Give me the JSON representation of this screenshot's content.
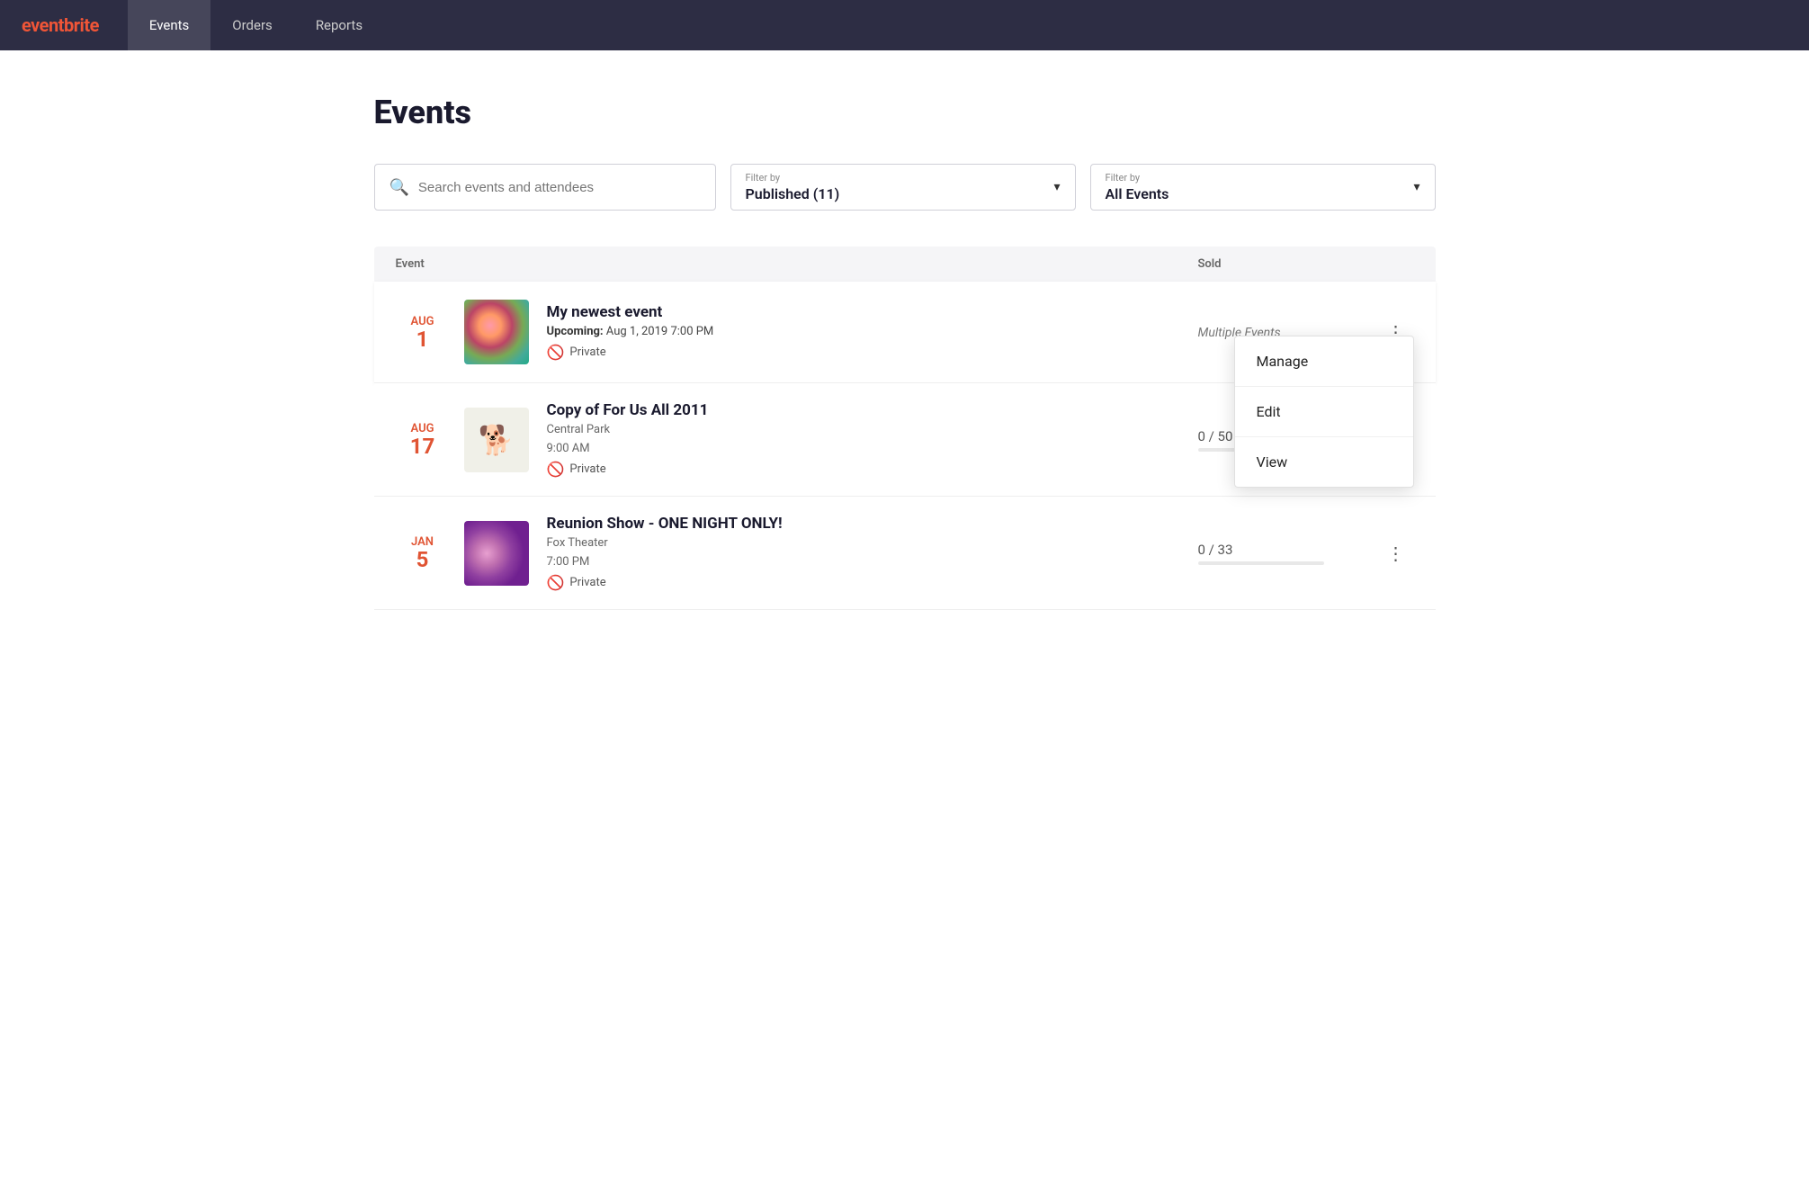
{
  "nav": {
    "logo": "eventbrite",
    "links": [
      {
        "id": "events",
        "label": "Events",
        "active": true
      },
      {
        "id": "orders",
        "label": "Orders",
        "active": false
      },
      {
        "id": "reports",
        "label": "Reports",
        "active": false
      }
    ]
  },
  "page": {
    "title": "Events"
  },
  "search": {
    "placeholder": "Search events and attendees"
  },
  "filters": [
    {
      "label": "Filter by",
      "value": "Published (11)"
    },
    {
      "label": "Filter by",
      "value": "All Events"
    }
  ],
  "table": {
    "columns": {
      "event": "Event",
      "sold": "Sold"
    },
    "rows": [
      {
        "id": "row1",
        "date_month": "Aug",
        "date_day": "1",
        "name": "My newest event",
        "meta_line1": "Upcoming:  Aug 1, 2019 7:00 PM",
        "meta_line2": "",
        "is_upcoming": true,
        "private": true,
        "sold_text": "Multiple Events",
        "sold_bar_pct": 0,
        "thumb_type": "bokeh",
        "show_menu": true
      },
      {
        "id": "row2",
        "date_month": "Aug",
        "date_day": "17",
        "name": "Copy of For Us All 2011",
        "meta_line1": "Central Park",
        "meta_line2": "9:00 AM",
        "is_upcoming": false,
        "private": true,
        "sold_text": "0 / 50",
        "sold_bar_pct": 0,
        "thumb_type": "cartoon"
      },
      {
        "id": "row3",
        "date_month": "Jan",
        "date_day": "5",
        "name": "Reunion Show - ONE NIGHT ONLY!",
        "meta_line1": "Fox Theater",
        "meta_line2": "7:00 PM",
        "is_upcoming": false,
        "private": true,
        "sold_text": "0 / 33",
        "sold_bar_pct": 0,
        "thumb_type": "bokeh-purple"
      }
    ]
  },
  "context_menu": {
    "items": [
      "Manage",
      "Edit",
      "View"
    ]
  }
}
